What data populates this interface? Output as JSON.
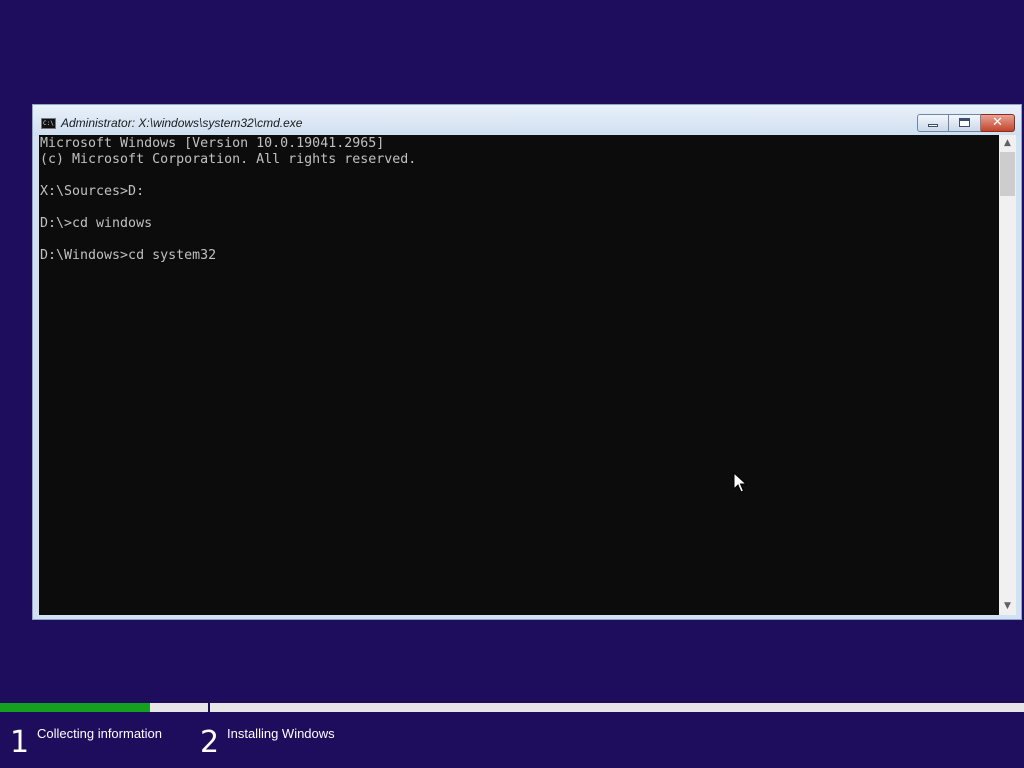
{
  "window": {
    "title": "Administrator: X:\\windows\\system32\\cmd.exe",
    "icon_text": "C:\\",
    "buttons": {
      "minimize": "minimize-icon",
      "maximize": "maximize-icon",
      "close": "✕"
    }
  },
  "console": {
    "lines": [
      "Microsoft Windows [Version 10.0.19041.2965]",
      "(c) Microsoft Corporation. All rights reserved.",
      "",
      "X:\\Sources>D:",
      "",
      "D:\\>cd windows",
      "",
      "D:\\Windows>cd system32"
    ],
    "text_color": "#c0c0c0",
    "background_color": "#0c0c0c"
  },
  "scrollbar": {
    "up_arrow": "▲",
    "down_arrow": "▼"
  },
  "setup": {
    "background_color": "#1e0c5c",
    "progress_color": "#16a020",
    "step1_progress_fraction": 0.72,
    "steps": [
      {
        "number": "1",
        "label": "Collecting information"
      },
      {
        "number": "2",
        "label": "Installing Windows"
      }
    ]
  }
}
